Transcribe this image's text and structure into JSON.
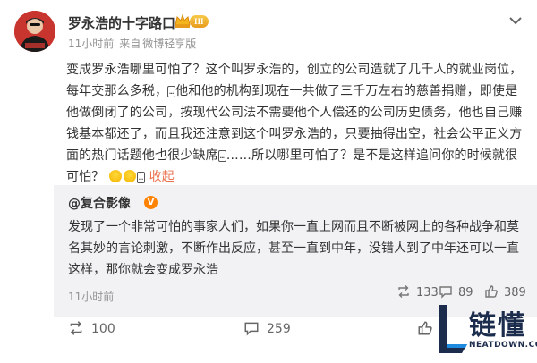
{
  "post": {
    "author": "罗永浩的十字路口",
    "level_badge": "III",
    "time": "11小时前",
    "source_prefix": "来自",
    "source": "微博轻享版",
    "text_1": "变成罗永浩哪里可怕了？这个叫罗永浩的，创立的公司造就了几千人的就业岗位，每年交那么多税，",
    "emoji_dots": "…",
    "text_2": "他和他的机构到现在一共做了三千万左右的慈善捐赠，即使是他做倒闭了的公司，按现代公司法不需要他个人偿还的公司历史债务，他也自己赚钱基本都还了，而且我还注意到这个叫罗永浩的，只要抽得出空，社会公平正义方面的热门话题他也很少缺席",
    "text_3": "……所以哪里可怕了？是不是这样追问你的时候就很可怕？",
    "fold_link": "收起"
  },
  "retweet": {
    "author": "@复合影像",
    "text": "发现了一个非常可怕的事家人们，如果你一直上网而且不断被网上的各种战争和莫名其妙的言论刺激，不断作出反应，甚至一直到中年，没错人到了中年还可以一直这样，那你就会变成罗永浩",
    "time": "11小时前",
    "reposts": "133",
    "comments": "89",
    "likes": "389"
  },
  "actions": {
    "reposts": "100",
    "comments": "259"
  },
  "watermark": {
    "text": "链懂",
    "url": "NEATDOWN.COM"
  },
  "colors": {
    "accent": "#eb7350",
    "retweet_bg": "#f2f2f5",
    "meta_gray": "#939393",
    "watermark_navy": "#1c2c4d"
  },
  "icons": {
    "badge": "crown-icon",
    "menu": "chevron-down-icon",
    "repost": "repost-icon",
    "comment": "comment-icon",
    "like": "thumbs-up-icon"
  }
}
